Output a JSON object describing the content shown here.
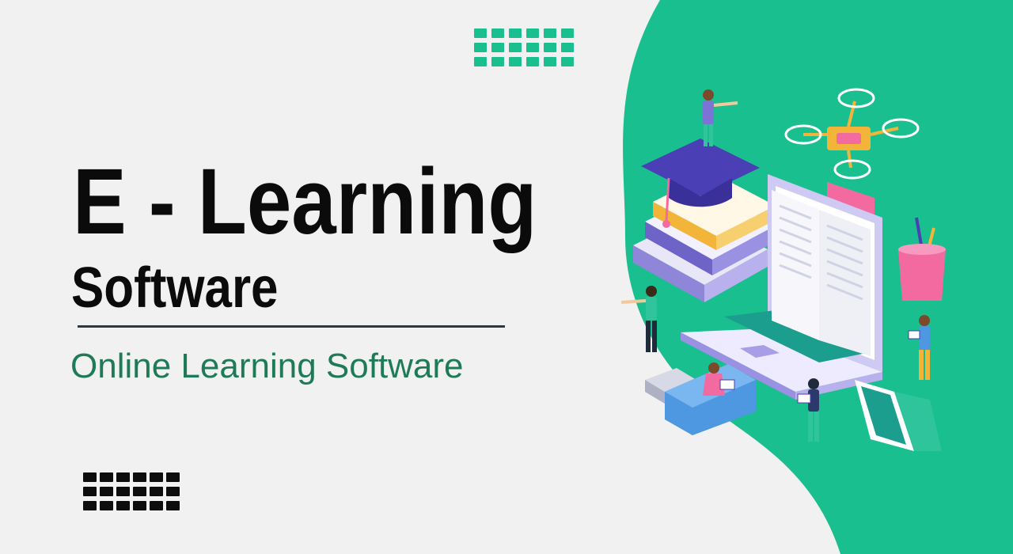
{
  "banner": {
    "title": "E - Learning",
    "subtitle": "Software",
    "tagline": "Online Learning Software"
  },
  "colors": {
    "accent_green": "#1abf8f",
    "tagline_green": "#1f7b57",
    "background": "#f1f1f1",
    "text_dark": "#0b0b0b"
  },
  "illustration": {
    "icons": [
      "graduation-cap-icon",
      "books-icon",
      "laptop-icon",
      "open-book-icon",
      "drone-icon",
      "pencil-cup-icon",
      "usb-drive-icon",
      "calculator-icon",
      "student-figure-icon"
    ]
  }
}
